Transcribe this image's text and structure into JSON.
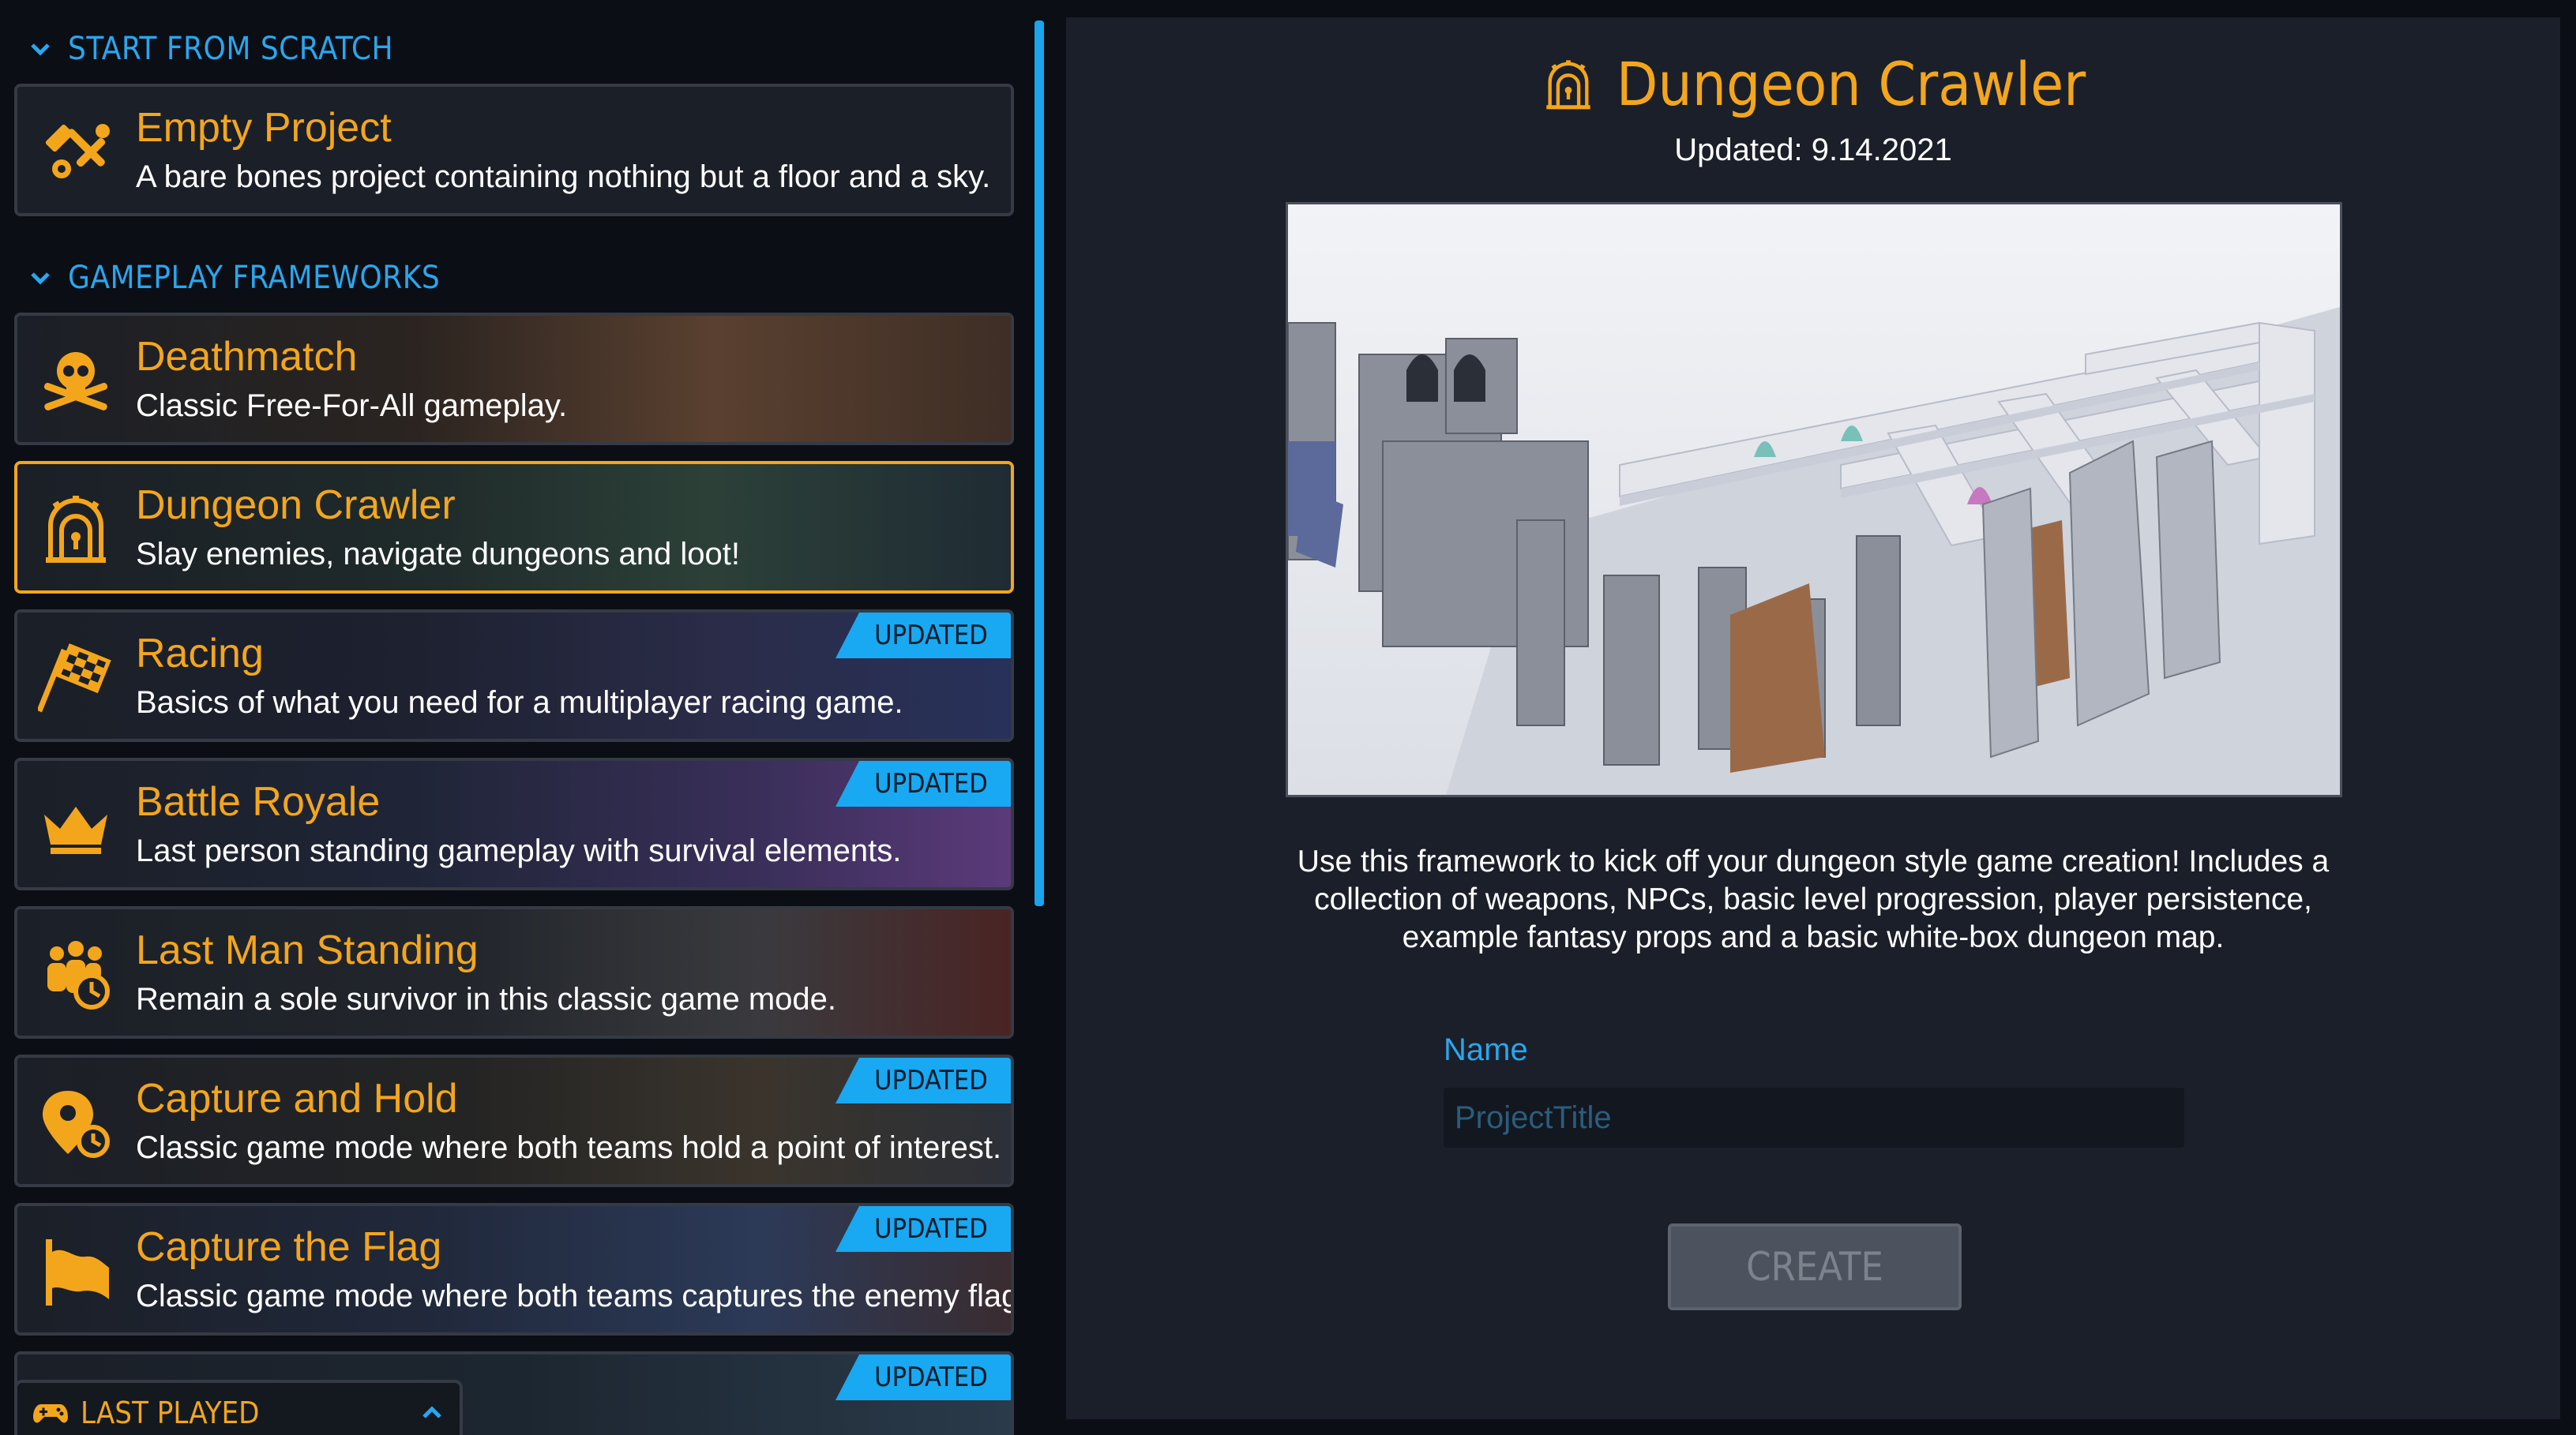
{
  "sections": {
    "scratch": {
      "label": "START FROM SCRATCH"
    },
    "frameworks": {
      "label": "GAMEPLAY FRAMEWORKS"
    }
  },
  "empty_project": {
    "title": "Empty Project",
    "description": "A bare bones project containing nothing but a floor and a sky.",
    "icon": "hammer-wrench-icon"
  },
  "frameworks": [
    {
      "title": "Deathmatch",
      "description": "Classic Free-For-All gameplay.",
      "icon": "skull-crossbones-icon",
      "badge": ""
    },
    {
      "title": "Dungeon Crawler",
      "description": "Slay enemies, navigate dungeons and loot!",
      "icon": "dungeon-door-icon",
      "badge": "",
      "selected": true
    },
    {
      "title": "Racing",
      "description": "Basics of what you need for a multiplayer racing game.",
      "icon": "checkered-flag-icon",
      "badge": "UPDATED"
    },
    {
      "title": "Battle Royale",
      "description": "Last person standing gameplay with survival elements.",
      "icon": "crown-icon",
      "badge": "UPDATED"
    },
    {
      "title": "Last Man Standing",
      "description": "Remain a sole survivor in this classic game mode.",
      "icon": "group-timer-icon",
      "badge": ""
    },
    {
      "title": "Capture and Hold",
      "description": "Classic game mode where both teams hold a point of interest.",
      "icon": "map-pin-timer-icon",
      "badge": "UPDATED"
    },
    {
      "title": "Capture the Flag",
      "description": "Classic game mode where both teams captures the enemy flags.",
      "icon": "flag-icon",
      "badge": "UPDATED"
    },
    {
      "title": "",
      "description": "",
      "icon": "",
      "badge": "UPDATED"
    }
  ],
  "last_played": {
    "label": "LAST PLAYED",
    "icon": "gamepad-icon"
  },
  "detail": {
    "title": "Dungeon Crawler",
    "updated": "Updated: 9.14.2021",
    "description": "Use this framework to kick off your dungeon style game creation! Includes a collection of weapons, NPCs, basic level progression, player persistence, example fantasy props and a basic white-box dungeon map.",
    "name_label": "Name",
    "name_placeholder": "ProjectTitle",
    "name_value": "",
    "create_label": "CREATE"
  },
  "colors": {
    "accent_orange": "#f3a61c",
    "accent_blue": "#19a8f2",
    "panel": "#1a1f29",
    "background": "#0b0e14"
  }
}
